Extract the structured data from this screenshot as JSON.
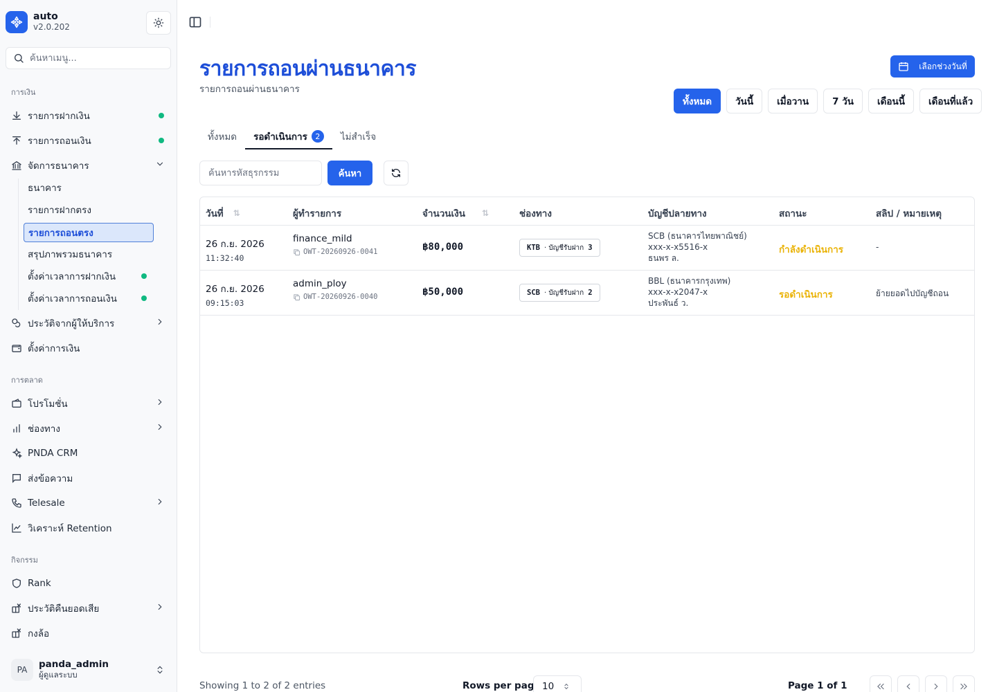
{
  "app": {
    "name": "auto",
    "version": "v2.0.202"
  },
  "menu_search": {
    "placeholder": "ค้นหาเมนู..."
  },
  "sidebar": {
    "sections": [
      {
        "label": "การเงิน"
      },
      {
        "label": "การตลาด"
      },
      {
        "label": "กิจกรรม"
      }
    ],
    "finance_items": [
      {
        "label": "รายการฝากเงิน"
      },
      {
        "label": "รายการถอนเงิน"
      },
      {
        "label": "จัดการธนาคาร"
      }
    ],
    "bank_sub_items": [
      {
        "label": "ธนาคาร"
      },
      {
        "label": "รายการฝากตรง"
      },
      {
        "label": "รายการถอนตรง"
      },
      {
        "label": "สรุปภาพรวมธนาคาร"
      },
      {
        "label": "ตั้งค่าเวลาการฝากเงิน"
      },
      {
        "label": "ตั้งค่าเวลาการถอนเงิน"
      }
    ],
    "finance_items_after": [
      {
        "label": "ประวัติจากผู้ให้บริการ"
      },
      {
        "label": "ตั้งค่าการเงิน"
      }
    ],
    "marketing_items": [
      {
        "label": "โปรโมชั่น"
      },
      {
        "label": "ช่องทาง"
      },
      {
        "label": "PNDA CRM"
      },
      {
        "label": "ส่งข้อความ"
      },
      {
        "label": "Telesale"
      },
      {
        "label": "วิเคราะห์ Retention"
      }
    ],
    "activity_items": [
      {
        "label": "Rank"
      },
      {
        "label": "ประวัติคืนยอดเสีย"
      },
      {
        "label": "กงล้อ"
      }
    ],
    "status_color": "#10b981"
  },
  "user": {
    "initials": "PA",
    "name": "panda_admin",
    "role": "ผู้ดูแลระบบ"
  },
  "page": {
    "title": "รายการถอนผ่านธนาคาร",
    "subtitle": "รายการถอนผ่านธนาคาร",
    "date_range_label": "เลือกช่วงวันที่",
    "quick_filters": [
      "ทั้งหมด",
      "วันนี้",
      "เมื่อวาน",
      "7 วัน",
      "เดือนนี้",
      "เดือนที่แล้ว"
    ],
    "active_quick_filter": "ทั้งหมด"
  },
  "tabs": [
    {
      "label": "ทั้งหมด"
    },
    {
      "label": "รอดำเนินการ",
      "badge": "2"
    },
    {
      "label": "ไม่สำเร็จ"
    }
  ],
  "search": {
    "placeholder": "ค้นหารหัสธุรกรรม",
    "button_label": "ค้นหา"
  },
  "table": {
    "columns": [
      "วันที่",
      "ผู้ทำรายการ",
      "จำนวนเงิน",
      "ช่องทาง",
      "บัญชีปลายทาง",
      "สถานะ",
      "สลิป / หมายเหตุ"
    ],
    "rows": [
      {
        "date": "26 ก.ย. 2026",
        "time": "11:32:40",
        "maker": "finance_mild",
        "ref": "OWT-20260926-0041",
        "amount": "฿80,000",
        "channel_bank": "KTB",
        "channel_type": "บัญชีรับฝาก",
        "channel_no": "3",
        "dest_bank": "SCB (ธนาคารไทยพาณิชย์)",
        "dest_account": "xxx-x-x5516-x",
        "dest_name": "ธนพร ล.",
        "status": "กำลังดำเนินการ",
        "note": "-"
      },
      {
        "date": "26 ก.ย. 2026",
        "time": "09:15:03",
        "maker": "admin_ploy",
        "ref": "OWT-20260926-0040",
        "amount": "฿50,000",
        "channel_bank": "SCB",
        "channel_type": "บัญชีรับฝาก",
        "channel_no": "2",
        "dest_bank": "BBL (ธนาคารกรุงเทพ)",
        "dest_account": "xxx-x-x2047-x",
        "dest_name": "ประพันธ์ ว.",
        "status": "รอดำเนินการ",
        "note": "ย้ายยอดไปบัญชีถอน"
      }
    ]
  },
  "footer": {
    "showing": "Showing 1 to 2 of 2 entries",
    "rows_per_page_label": "Rows per page",
    "rows_per_page_value": "10",
    "page_label": "Page 1 of 1"
  },
  "colors": {
    "primary": "#2563eb",
    "status_pending": "#eab308",
    "online_dot": "#10b981"
  }
}
